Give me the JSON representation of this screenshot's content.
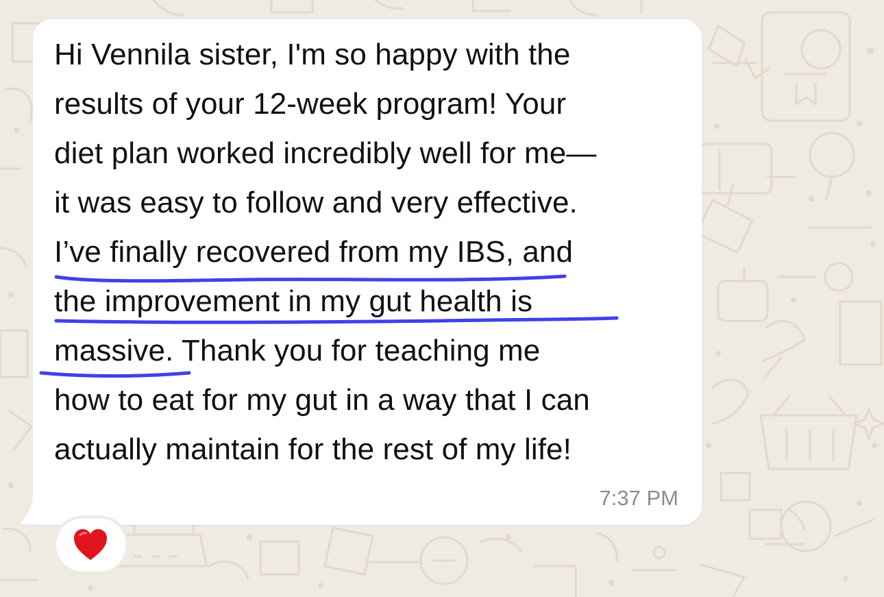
{
  "message": {
    "lines": [
      "Hi Vennila sister, I'm so happy with the",
      "results of your 12-week program! Your",
      "diet plan worked incredibly well for me—",
      "it was easy to follow and very effective.",
      "I’ve finally recovered from my IBS, and",
      "the improvement in my gut health is",
      "massive. Thank you for teaching me",
      "how to eat for my gut in a way that I can",
      "actually maintain for the rest of my life!"
    ],
    "time": "7:37 PM"
  },
  "reaction": {
    "icon": "heart-icon",
    "color": "#e0141e"
  },
  "colors": {
    "wallpaper": "#efeae2",
    "doodles": "#e3d6c5",
    "bubble": "#ffffff",
    "underline": "#3f42e8"
  }
}
